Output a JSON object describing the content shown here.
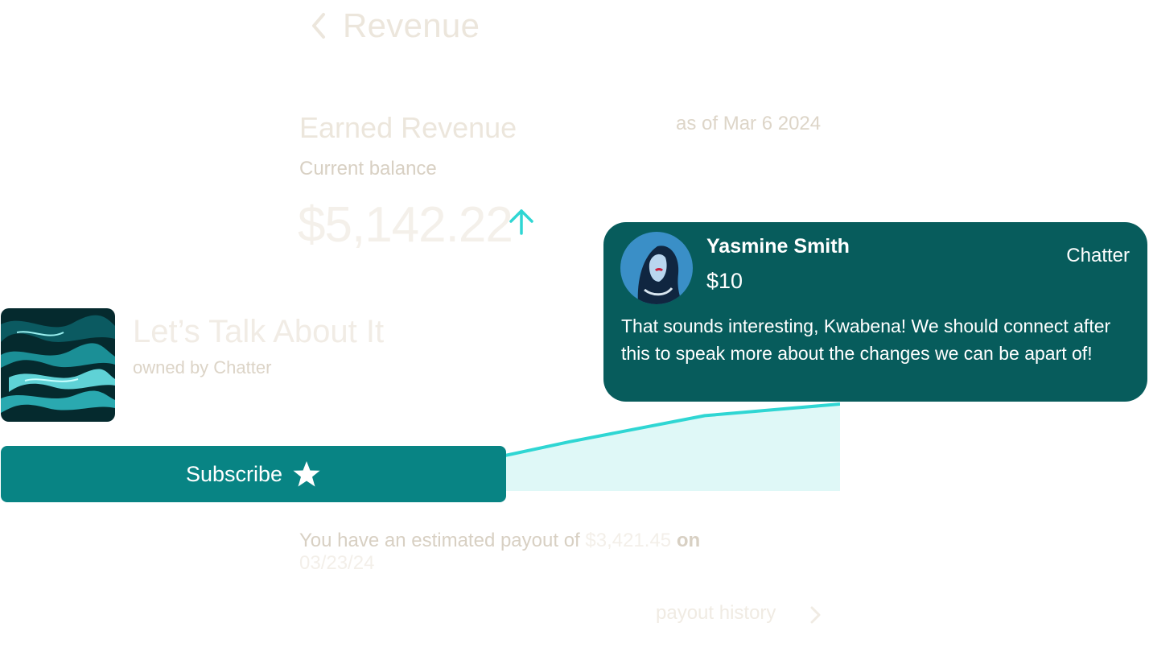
{
  "header": {
    "title": "Revenue",
    "back_icon": "chevron-left-icon"
  },
  "revenue": {
    "section_title": "Earned Revenue",
    "as_of": "as of Mar 6 2024",
    "balance_label": "Current balance",
    "balance_amount": "$5,142.22",
    "trend_icon": "arrow-up-icon",
    "payout_prefix": "You have an estimated payout of ",
    "payout_amount": "$3,421.45",
    "payout_on": " on",
    "payout_date": "03/23/24",
    "history_link": "payout history",
    "history_icon": "chevron-right-icon"
  },
  "chart_data": {
    "type": "area",
    "xlabel": "",
    "ylabel": "",
    "series": [
      {
        "values": [
          10,
          14,
          34,
          52,
          60
        ]
      }
    ],
    "ylim": [
      0,
      100
    ],
    "grid": false
  },
  "show": {
    "title": "Let’s Talk About It",
    "owner": "owned by Chatter",
    "subscribe_label": "Subscribe",
    "subscribe_icon": "star-icon"
  },
  "message": {
    "sender": "Yasmine Smith",
    "amount": "$10",
    "channel": "Chatter",
    "text": "That sounds interesting, Kwabena! We should connect after this to speak more about the changes we can be apart of!"
  },
  "colors": {
    "accent": "#2fd6d3",
    "subscribe_bg": "#088484",
    "bubble_bg": "#075c5c",
    "area_fill": "#dff8f7",
    "faded_text": "#ece6dc"
  }
}
